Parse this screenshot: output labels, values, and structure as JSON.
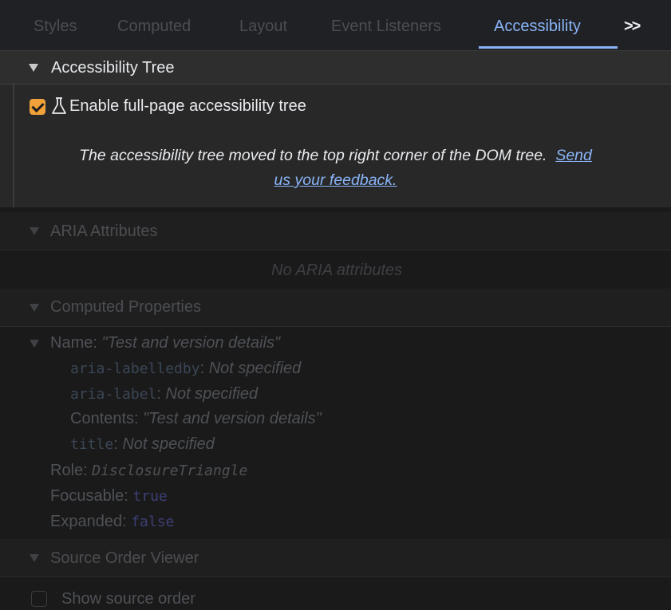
{
  "tabs": [
    {
      "label": "Styles"
    },
    {
      "label": "Computed"
    },
    {
      "label": "Layout"
    },
    {
      "label": "Event Listeners"
    },
    {
      "label": "Accessibility"
    }
  ],
  "overflow_label": ">>",
  "accessibility_tree": {
    "title": "Accessibility Tree",
    "enable_label": "Enable full-page accessibility tree",
    "enabled": true,
    "note_text": "The accessibility tree moved to the top right corner of the DOM tree.",
    "note_link_part1": "Send",
    "note_link_part2": "us your feedback."
  },
  "aria": {
    "title": "ARIA Attributes",
    "empty_text": "No ARIA attributes"
  },
  "computed": {
    "title": "Computed Properties",
    "name_label": "Name:",
    "name_value": "\"Test and version details\"",
    "aria_labelledby": "aria-labelledby",
    "aria_label": "aria-label",
    "not_specified": "Not specified",
    "contents_label": "Contents:",
    "contents_value": "\"Test and version details\"",
    "title_attr": "title",
    "role_label": "Role:",
    "role_value": "DisclosureTriangle",
    "focusable_label": "Focusable:",
    "focusable_value": "true",
    "expanded_label": "Expanded:",
    "expanded_value": "false"
  },
  "source_order": {
    "title": "Source Order Viewer",
    "show_label": "Show source order"
  },
  "colors": {
    "accent": "#8ab4f8",
    "checkbox": "#f0a13a"
  }
}
